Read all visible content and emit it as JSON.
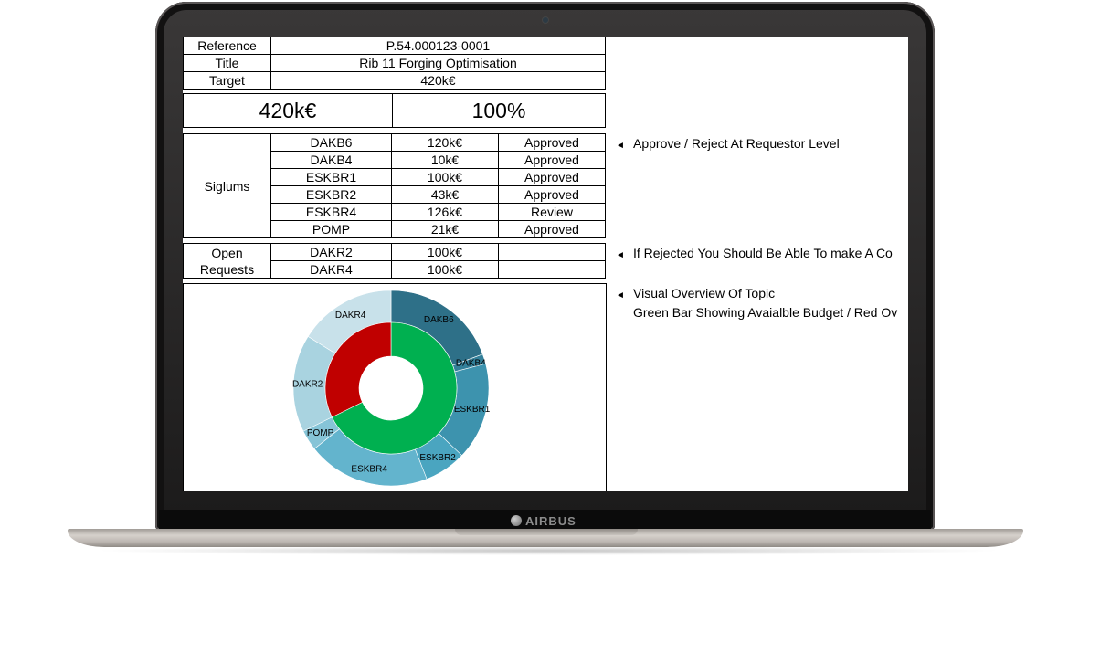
{
  "brand": {
    "name": "AIRBUS"
  },
  "header_rows": [
    {
      "label": "Reference",
      "value": "P.54.000123-0001"
    },
    {
      "label": "Title",
      "value": "Rib 11 Forging Optimisation"
    },
    {
      "label": "Target",
      "value": "420k€"
    }
  ],
  "summary": {
    "amount": "420k€",
    "percent": "100%"
  },
  "siglums": {
    "label": "Siglums",
    "rows": [
      {
        "code": "DAKB6",
        "amount": "120k€",
        "status": "Approved"
      },
      {
        "code": "DAKB4",
        "amount": "10k€",
        "status": "Approved"
      },
      {
        "code": "ESKBR1",
        "amount": "100k€",
        "status": "Approved"
      },
      {
        "code": "ESKBR2",
        "amount": "43k€",
        "status": "Approved"
      },
      {
        "code": "ESKBR4",
        "amount": "126k€",
        "status": "Review"
      },
      {
        "code": "POMP",
        "amount": "21k€",
        "status": "Approved"
      }
    ]
  },
  "open_requests": {
    "label_line1": "Open",
    "label_line2": "Requests",
    "rows": [
      {
        "code": "DAKR2",
        "amount": "100k€",
        "status": ""
      },
      {
        "code": "DAKR4",
        "amount": "100k€",
        "status": ""
      }
    ]
  },
  "notes": {
    "arrow_icon": "◄",
    "approve": "Approve / Reject At Requestor Level",
    "rejected": "If Rejected You Should Be Able To make A Co",
    "visual_line1": "Visual Overview Of Topic",
    "visual_line2": "Green Bar Showing Avaialble Budget / Red Ov"
  },
  "chart_data": {
    "type": "pie",
    "variant": "two-ring donut",
    "outer_ring": [
      {
        "label": "DAKB6",
        "value": 120,
        "color": "#2e7088"
      },
      {
        "label": "DAKB4",
        "value": 10,
        "color": "#33809a"
      },
      {
        "label": "ESKBR1",
        "value": 100,
        "color": "#3d93ae"
      },
      {
        "label": "ESKBR2",
        "value": 43,
        "color": "#4aa5c0"
      },
      {
        "label": "ESKBR4",
        "value": 126,
        "color": "#63b4cd"
      },
      {
        "label": "POMP",
        "value": 21,
        "color": "#86c4d7"
      },
      {
        "label": "DAKR2",
        "value": 100,
        "color": "#a9d3e0"
      },
      {
        "label": "DAKR4",
        "value": 100,
        "color": "#c8e1ea"
      }
    ],
    "inner_ring": [
      {
        "label": "",
        "value": 420,
        "color": "#00b050"
      },
      {
        "label": "",
        "value": 200,
        "color": "#c00000"
      }
    ]
  }
}
